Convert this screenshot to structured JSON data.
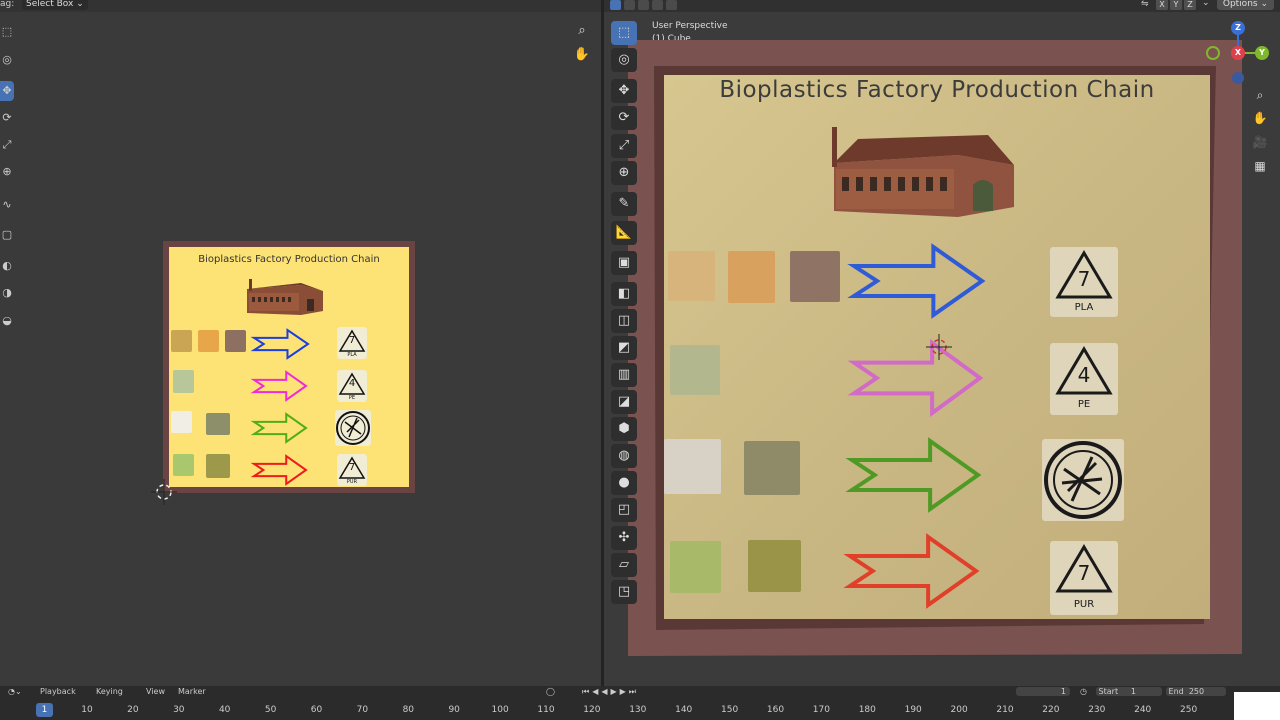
{
  "left_editor": {
    "drag_label": "ag:",
    "select_box": "Select Box",
    "poster_title": "Bioplastics Factory Production Chain"
  },
  "viewport": {
    "perspective_label": "User Perspective",
    "object_label": "(1) Cube",
    "options_label": "Options",
    "axes": [
      "X",
      "Y",
      "Z"
    ],
    "gizmo": {
      "x": "X",
      "y": "Y",
      "z": "Z"
    },
    "poster_title": "Bioplastics Factory Production Chain",
    "rows": [
      {
        "arrow_color": "#2f5bd6",
        "symbol_code": "7",
        "symbol_label": "PLA"
      },
      {
        "arrow_color": "#d26ac8",
        "symbol_code": "4",
        "symbol_label": "PE"
      },
      {
        "arrow_color": "#4f9a25",
        "symbol_code": "",
        "symbol_label": ""
      },
      {
        "arrow_color": "#e0402a",
        "symbol_code": "7",
        "symbol_label": "PUR"
      }
    ]
  },
  "left_poster_rows": [
    {
      "arrow_color": "#1b3fe0",
      "symbol_code": "7",
      "symbol_label": "PLA"
    },
    {
      "arrow_color": "#f02ad6",
      "symbol_code": "4",
      "symbol_label": "PE"
    },
    {
      "arrow_color": "#4fae18",
      "symbol_code": "",
      "symbol_label": ""
    },
    {
      "arrow_color": "#ee1b1b",
      "symbol_code": "7",
      "symbol_label": "PUR"
    }
  ],
  "timeline": {
    "menu": [
      "Playback",
      "Keying",
      "View",
      "Marker"
    ],
    "current_frame": "1",
    "ticks": [
      "10",
      "20",
      "30",
      "40",
      "50",
      "60",
      "70",
      "80",
      "90",
      "100",
      "110",
      "120",
      "130",
      "140",
      "150",
      "160",
      "170",
      "180",
      "190",
      "200",
      "210",
      "220",
      "230",
      "240",
      "250"
    ],
    "start_label": "Start",
    "start_value": "1",
    "end_label": "End",
    "end_value": "250",
    "frame_field": "1"
  }
}
